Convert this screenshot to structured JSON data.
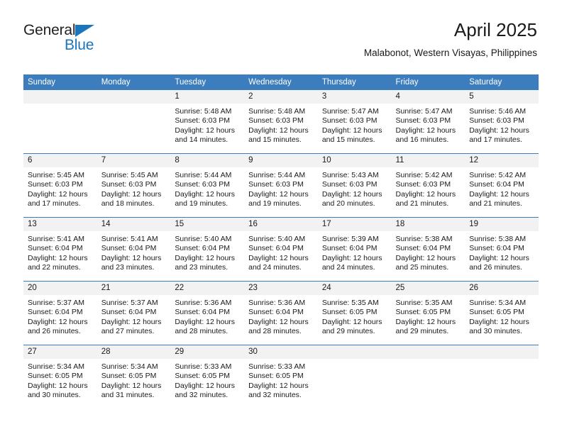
{
  "brand": {
    "name_part1": "General",
    "name_part2": "Blue",
    "accent_color": "#1b75bb",
    "logo_icon": "triangle-flag-icon"
  },
  "header": {
    "title": "April 2025",
    "subtitle": "Malabonot, Western Visayas, Philippines"
  },
  "calendar": {
    "header_bg": "#3b7dbd",
    "daynum_bg": "#f2f2f2",
    "weekday_headers": [
      "Sunday",
      "Monday",
      "Tuesday",
      "Wednesday",
      "Thursday",
      "Friday",
      "Saturday"
    ],
    "weeks": [
      [
        {
          "day": "",
          "empty": true,
          "sunrise": "",
          "sunset": "",
          "daylight_line1": "",
          "daylight_line2": ""
        },
        {
          "day": "",
          "empty": true,
          "sunrise": "",
          "sunset": "",
          "daylight_line1": "",
          "daylight_line2": ""
        },
        {
          "day": "1",
          "empty": false,
          "sunrise": "Sunrise: 5:48 AM",
          "sunset": "Sunset: 6:03 PM",
          "daylight_line1": "Daylight: 12 hours",
          "daylight_line2": "and 14 minutes."
        },
        {
          "day": "2",
          "empty": false,
          "sunrise": "Sunrise: 5:48 AM",
          "sunset": "Sunset: 6:03 PM",
          "daylight_line1": "Daylight: 12 hours",
          "daylight_line2": "and 15 minutes."
        },
        {
          "day": "3",
          "empty": false,
          "sunrise": "Sunrise: 5:47 AM",
          "sunset": "Sunset: 6:03 PM",
          "daylight_line1": "Daylight: 12 hours",
          "daylight_line2": "and 15 minutes."
        },
        {
          "day": "4",
          "empty": false,
          "sunrise": "Sunrise: 5:47 AM",
          "sunset": "Sunset: 6:03 PM",
          "daylight_line1": "Daylight: 12 hours",
          "daylight_line2": "and 16 minutes."
        },
        {
          "day": "5",
          "empty": false,
          "sunrise": "Sunrise: 5:46 AM",
          "sunset": "Sunset: 6:03 PM",
          "daylight_line1": "Daylight: 12 hours",
          "daylight_line2": "and 17 minutes."
        }
      ],
      [
        {
          "day": "6",
          "empty": false,
          "sunrise": "Sunrise: 5:45 AM",
          "sunset": "Sunset: 6:03 PM",
          "daylight_line1": "Daylight: 12 hours",
          "daylight_line2": "and 17 minutes."
        },
        {
          "day": "7",
          "empty": false,
          "sunrise": "Sunrise: 5:45 AM",
          "sunset": "Sunset: 6:03 PM",
          "daylight_line1": "Daylight: 12 hours",
          "daylight_line2": "and 18 minutes."
        },
        {
          "day": "8",
          "empty": false,
          "sunrise": "Sunrise: 5:44 AM",
          "sunset": "Sunset: 6:03 PM",
          "daylight_line1": "Daylight: 12 hours",
          "daylight_line2": "and 19 minutes."
        },
        {
          "day": "9",
          "empty": false,
          "sunrise": "Sunrise: 5:44 AM",
          "sunset": "Sunset: 6:03 PM",
          "daylight_line1": "Daylight: 12 hours",
          "daylight_line2": "and 19 minutes."
        },
        {
          "day": "10",
          "empty": false,
          "sunrise": "Sunrise: 5:43 AM",
          "sunset": "Sunset: 6:03 PM",
          "daylight_line1": "Daylight: 12 hours",
          "daylight_line2": "and 20 minutes."
        },
        {
          "day": "11",
          "empty": false,
          "sunrise": "Sunrise: 5:42 AM",
          "sunset": "Sunset: 6:03 PM",
          "daylight_line1": "Daylight: 12 hours",
          "daylight_line2": "and 21 minutes."
        },
        {
          "day": "12",
          "empty": false,
          "sunrise": "Sunrise: 5:42 AM",
          "sunset": "Sunset: 6:04 PM",
          "daylight_line1": "Daylight: 12 hours",
          "daylight_line2": "and 21 minutes."
        }
      ],
      [
        {
          "day": "13",
          "empty": false,
          "sunrise": "Sunrise: 5:41 AM",
          "sunset": "Sunset: 6:04 PM",
          "daylight_line1": "Daylight: 12 hours",
          "daylight_line2": "and 22 minutes."
        },
        {
          "day": "14",
          "empty": false,
          "sunrise": "Sunrise: 5:41 AM",
          "sunset": "Sunset: 6:04 PM",
          "daylight_line1": "Daylight: 12 hours",
          "daylight_line2": "and 23 minutes."
        },
        {
          "day": "15",
          "empty": false,
          "sunrise": "Sunrise: 5:40 AM",
          "sunset": "Sunset: 6:04 PM",
          "daylight_line1": "Daylight: 12 hours",
          "daylight_line2": "and 23 minutes."
        },
        {
          "day": "16",
          "empty": false,
          "sunrise": "Sunrise: 5:40 AM",
          "sunset": "Sunset: 6:04 PM",
          "daylight_line1": "Daylight: 12 hours",
          "daylight_line2": "and 24 minutes."
        },
        {
          "day": "17",
          "empty": false,
          "sunrise": "Sunrise: 5:39 AM",
          "sunset": "Sunset: 6:04 PM",
          "daylight_line1": "Daylight: 12 hours",
          "daylight_line2": "and 24 minutes."
        },
        {
          "day": "18",
          "empty": false,
          "sunrise": "Sunrise: 5:38 AM",
          "sunset": "Sunset: 6:04 PM",
          "daylight_line1": "Daylight: 12 hours",
          "daylight_line2": "and 25 minutes."
        },
        {
          "day": "19",
          "empty": false,
          "sunrise": "Sunrise: 5:38 AM",
          "sunset": "Sunset: 6:04 PM",
          "daylight_line1": "Daylight: 12 hours",
          "daylight_line2": "and 26 minutes."
        }
      ],
      [
        {
          "day": "20",
          "empty": false,
          "sunrise": "Sunrise: 5:37 AM",
          "sunset": "Sunset: 6:04 PM",
          "daylight_line1": "Daylight: 12 hours",
          "daylight_line2": "and 26 minutes."
        },
        {
          "day": "21",
          "empty": false,
          "sunrise": "Sunrise: 5:37 AM",
          "sunset": "Sunset: 6:04 PM",
          "daylight_line1": "Daylight: 12 hours",
          "daylight_line2": "and 27 minutes."
        },
        {
          "day": "22",
          "empty": false,
          "sunrise": "Sunrise: 5:36 AM",
          "sunset": "Sunset: 6:04 PM",
          "daylight_line1": "Daylight: 12 hours",
          "daylight_line2": "and 28 minutes."
        },
        {
          "day": "23",
          "empty": false,
          "sunrise": "Sunrise: 5:36 AM",
          "sunset": "Sunset: 6:04 PM",
          "daylight_line1": "Daylight: 12 hours",
          "daylight_line2": "and 28 minutes."
        },
        {
          "day": "24",
          "empty": false,
          "sunrise": "Sunrise: 5:35 AM",
          "sunset": "Sunset: 6:05 PM",
          "daylight_line1": "Daylight: 12 hours",
          "daylight_line2": "and 29 minutes."
        },
        {
          "day": "25",
          "empty": false,
          "sunrise": "Sunrise: 5:35 AM",
          "sunset": "Sunset: 6:05 PM",
          "daylight_line1": "Daylight: 12 hours",
          "daylight_line2": "and 29 minutes."
        },
        {
          "day": "26",
          "empty": false,
          "sunrise": "Sunrise: 5:34 AM",
          "sunset": "Sunset: 6:05 PM",
          "daylight_line1": "Daylight: 12 hours",
          "daylight_line2": "and 30 minutes."
        }
      ],
      [
        {
          "day": "27",
          "empty": false,
          "sunrise": "Sunrise: 5:34 AM",
          "sunset": "Sunset: 6:05 PM",
          "daylight_line1": "Daylight: 12 hours",
          "daylight_line2": "and 30 minutes."
        },
        {
          "day": "28",
          "empty": false,
          "sunrise": "Sunrise: 5:34 AM",
          "sunset": "Sunset: 6:05 PM",
          "daylight_line1": "Daylight: 12 hours",
          "daylight_line2": "and 31 minutes."
        },
        {
          "day": "29",
          "empty": false,
          "sunrise": "Sunrise: 5:33 AM",
          "sunset": "Sunset: 6:05 PM",
          "daylight_line1": "Daylight: 12 hours",
          "daylight_line2": "and 32 minutes."
        },
        {
          "day": "30",
          "empty": false,
          "sunrise": "Sunrise: 5:33 AM",
          "sunset": "Sunset: 6:05 PM",
          "daylight_line1": "Daylight: 12 hours",
          "daylight_line2": "and 32 minutes."
        },
        {
          "day": "",
          "empty": true,
          "sunrise": "",
          "sunset": "",
          "daylight_line1": "",
          "daylight_line2": ""
        },
        {
          "day": "",
          "empty": true,
          "sunrise": "",
          "sunset": "",
          "daylight_line1": "",
          "daylight_line2": ""
        },
        {
          "day": "",
          "empty": true,
          "sunrise": "",
          "sunset": "",
          "daylight_line1": "",
          "daylight_line2": ""
        }
      ]
    ]
  }
}
